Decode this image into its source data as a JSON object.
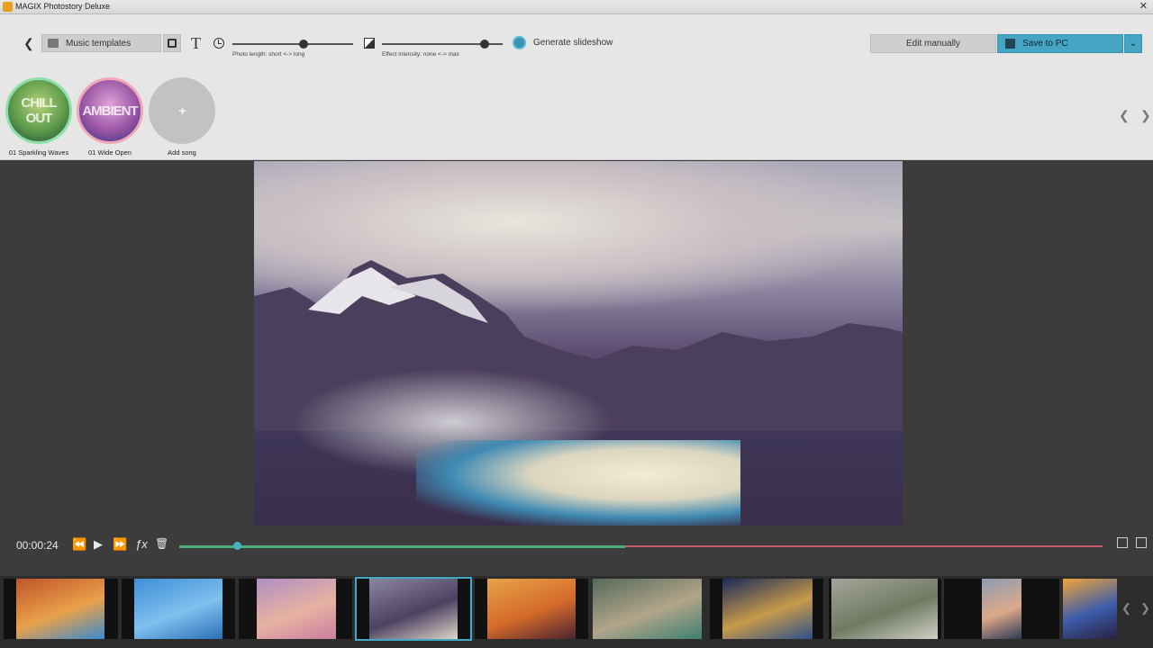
{
  "window": {
    "title": "MAGIX Photostory Deluxe",
    "close_glyph": "✕"
  },
  "toolbar": {
    "back_glyph": "❮",
    "music_templates_label": "Music templates",
    "text_tool_glyph": "T",
    "photo_length_caption": "Photo length: short <-> long",
    "photo_length_value": 0.6,
    "effect_intensity_caption": "Effect intensity: none <-> max",
    "effect_intensity_value": 0.88,
    "generate_label": "Generate slideshow",
    "edit_manually_label": "Edit manually",
    "save_label": "Save to PC",
    "save_dropdown_glyph": "⌄"
  },
  "songs": [
    {
      "name": "01 Sparkling Waves",
      "disc_text": "CHILL OUT"
    },
    {
      "name": "01 Wide Open",
      "disc_text": "AMBIENT"
    },
    {
      "name": "Add song",
      "disc_text": "+"
    }
  ],
  "song_nav": {
    "prev": "❮",
    "next": "❯"
  },
  "playback": {
    "time": "00:00:24",
    "rewind": "⏪",
    "play": "▶",
    "forward": "⏩",
    "fx": "ƒx",
    "delete": "🗑"
  },
  "filmstrip": {
    "prev": "❮",
    "next": "❯",
    "thumbnails": [
      {
        "name": "desert-arch",
        "colors": [
          "#c0542a",
          "#e9a14a",
          "#3a8ad0"
        ]
      },
      {
        "name": "dandelion",
        "colors": [
          "#3f8fd8",
          "#7fc0ee",
          "#2a70b8"
        ]
      },
      {
        "name": "butterfly-blossom",
        "colors": [
          "#b08ec2",
          "#e7b2a2",
          "#c97ea0"
        ]
      },
      {
        "name": "mountain-lake",
        "colors": [
          "#8c86a0",
          "#4d4262",
          "#dcd6c8"
        ]
      },
      {
        "name": "sunset-tree",
        "colors": [
          "#e7a347",
          "#d46a2a",
          "#4b2230"
        ]
      },
      {
        "name": "road-aerial",
        "colors": [
          "#566a5a",
          "#b2a58a",
          "#3f7f6f"
        ]
      },
      {
        "name": "city-night",
        "colors": [
          "#1b2b5a",
          "#c79a4a",
          "#2e4f8a"
        ]
      },
      {
        "name": "misty-valley",
        "colors": [
          "#a5a59a",
          "#6f7a62",
          "#d0d0c7"
        ]
      },
      {
        "name": "lake-sunrise",
        "colors": [
          "#8e9bb4",
          "#dca98a",
          "#2e3a55"
        ]
      },
      {
        "name": "elephant-sunset",
        "colors": [
          "#f0a43a",
          "#3c5caa",
          "#2b2040"
        ]
      }
    ]
  }
}
